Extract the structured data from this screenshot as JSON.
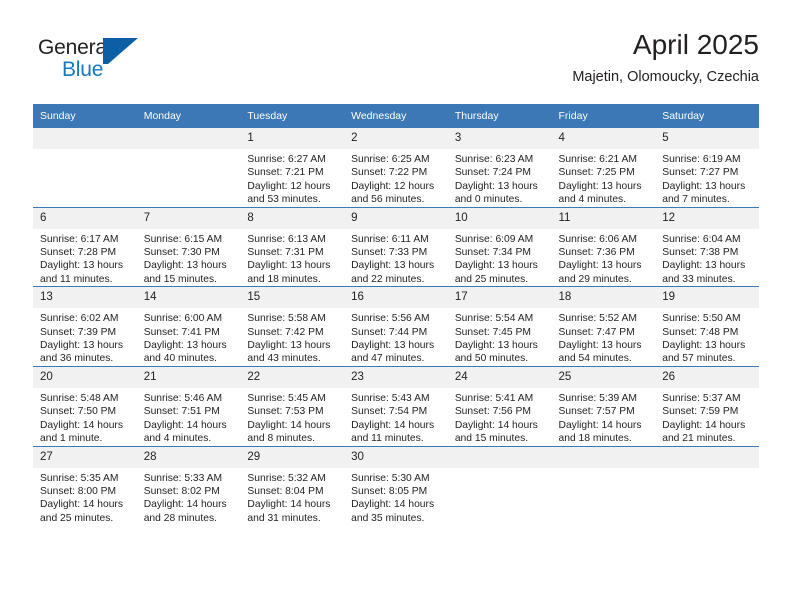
{
  "brand": {
    "name_part1": "General",
    "name_part2": "Blue",
    "mark": "triangle-logo"
  },
  "header": {
    "title": "April 2025",
    "subtitle": "Majetin, Olomoucky, Czechia"
  },
  "colors": {
    "header_blue": "#3b78b5",
    "brand_blue": "#1878be",
    "daynum_band": "#f1f1f1",
    "text": "#231f20"
  },
  "weekdays": [
    "Sunday",
    "Monday",
    "Tuesday",
    "Wednesday",
    "Thursday",
    "Friday",
    "Saturday"
  ],
  "weeks": [
    [
      {
        "day": "",
        "empty": true,
        "sunrise": "",
        "sunset": "",
        "daylight_line1": "",
        "daylight_line2": ""
      },
      {
        "day": "",
        "empty": true,
        "sunrise": "",
        "sunset": "",
        "daylight_line1": "",
        "daylight_line2": ""
      },
      {
        "day": "1",
        "empty": false,
        "sunrise": "Sunrise: 6:27 AM",
        "sunset": "Sunset: 7:21 PM",
        "daylight_line1": "Daylight: 12 hours",
        "daylight_line2": "and 53 minutes."
      },
      {
        "day": "2",
        "empty": false,
        "sunrise": "Sunrise: 6:25 AM",
        "sunset": "Sunset: 7:22 PM",
        "daylight_line1": "Daylight: 12 hours",
        "daylight_line2": "and 56 minutes."
      },
      {
        "day": "3",
        "empty": false,
        "sunrise": "Sunrise: 6:23 AM",
        "sunset": "Sunset: 7:24 PM",
        "daylight_line1": "Daylight: 13 hours",
        "daylight_line2": "and 0 minutes."
      },
      {
        "day": "4",
        "empty": false,
        "sunrise": "Sunrise: 6:21 AM",
        "sunset": "Sunset: 7:25 PM",
        "daylight_line1": "Daylight: 13 hours",
        "daylight_line2": "and 4 minutes."
      },
      {
        "day": "5",
        "empty": false,
        "sunrise": "Sunrise: 6:19 AM",
        "sunset": "Sunset: 7:27 PM",
        "daylight_line1": "Daylight: 13 hours",
        "daylight_line2": "and 7 minutes."
      }
    ],
    [
      {
        "day": "6",
        "empty": false,
        "sunrise": "Sunrise: 6:17 AM",
        "sunset": "Sunset: 7:28 PM",
        "daylight_line1": "Daylight: 13 hours",
        "daylight_line2": "and 11 minutes."
      },
      {
        "day": "7",
        "empty": false,
        "sunrise": "Sunrise: 6:15 AM",
        "sunset": "Sunset: 7:30 PM",
        "daylight_line1": "Daylight: 13 hours",
        "daylight_line2": "and 15 minutes."
      },
      {
        "day": "8",
        "empty": false,
        "sunrise": "Sunrise: 6:13 AM",
        "sunset": "Sunset: 7:31 PM",
        "daylight_line1": "Daylight: 13 hours",
        "daylight_line2": "and 18 minutes."
      },
      {
        "day": "9",
        "empty": false,
        "sunrise": "Sunrise: 6:11 AM",
        "sunset": "Sunset: 7:33 PM",
        "daylight_line1": "Daylight: 13 hours",
        "daylight_line2": "and 22 minutes."
      },
      {
        "day": "10",
        "empty": false,
        "sunrise": "Sunrise: 6:09 AM",
        "sunset": "Sunset: 7:34 PM",
        "daylight_line1": "Daylight: 13 hours",
        "daylight_line2": "and 25 minutes."
      },
      {
        "day": "11",
        "empty": false,
        "sunrise": "Sunrise: 6:06 AM",
        "sunset": "Sunset: 7:36 PM",
        "daylight_line1": "Daylight: 13 hours",
        "daylight_line2": "and 29 minutes."
      },
      {
        "day": "12",
        "empty": false,
        "sunrise": "Sunrise: 6:04 AM",
        "sunset": "Sunset: 7:38 PM",
        "daylight_line1": "Daylight: 13 hours",
        "daylight_line2": "and 33 minutes."
      }
    ],
    [
      {
        "day": "13",
        "empty": false,
        "sunrise": "Sunrise: 6:02 AM",
        "sunset": "Sunset: 7:39 PM",
        "daylight_line1": "Daylight: 13 hours",
        "daylight_line2": "and 36 minutes."
      },
      {
        "day": "14",
        "empty": false,
        "sunrise": "Sunrise: 6:00 AM",
        "sunset": "Sunset: 7:41 PM",
        "daylight_line1": "Daylight: 13 hours",
        "daylight_line2": "and 40 minutes."
      },
      {
        "day": "15",
        "empty": false,
        "sunrise": "Sunrise: 5:58 AM",
        "sunset": "Sunset: 7:42 PM",
        "daylight_line1": "Daylight: 13 hours",
        "daylight_line2": "and 43 minutes."
      },
      {
        "day": "16",
        "empty": false,
        "sunrise": "Sunrise: 5:56 AM",
        "sunset": "Sunset: 7:44 PM",
        "daylight_line1": "Daylight: 13 hours",
        "daylight_line2": "and 47 minutes."
      },
      {
        "day": "17",
        "empty": false,
        "sunrise": "Sunrise: 5:54 AM",
        "sunset": "Sunset: 7:45 PM",
        "daylight_line1": "Daylight: 13 hours",
        "daylight_line2": "and 50 minutes."
      },
      {
        "day": "18",
        "empty": false,
        "sunrise": "Sunrise: 5:52 AM",
        "sunset": "Sunset: 7:47 PM",
        "daylight_line1": "Daylight: 13 hours",
        "daylight_line2": "and 54 minutes."
      },
      {
        "day": "19",
        "empty": false,
        "sunrise": "Sunrise: 5:50 AM",
        "sunset": "Sunset: 7:48 PM",
        "daylight_line1": "Daylight: 13 hours",
        "daylight_line2": "and 57 minutes."
      }
    ],
    [
      {
        "day": "20",
        "empty": false,
        "sunrise": "Sunrise: 5:48 AM",
        "sunset": "Sunset: 7:50 PM",
        "daylight_line1": "Daylight: 14 hours",
        "daylight_line2": "and 1 minute."
      },
      {
        "day": "21",
        "empty": false,
        "sunrise": "Sunrise: 5:46 AM",
        "sunset": "Sunset: 7:51 PM",
        "daylight_line1": "Daylight: 14 hours",
        "daylight_line2": "and 4 minutes."
      },
      {
        "day": "22",
        "empty": false,
        "sunrise": "Sunrise: 5:45 AM",
        "sunset": "Sunset: 7:53 PM",
        "daylight_line1": "Daylight: 14 hours",
        "daylight_line2": "and 8 minutes."
      },
      {
        "day": "23",
        "empty": false,
        "sunrise": "Sunrise: 5:43 AM",
        "sunset": "Sunset: 7:54 PM",
        "daylight_line1": "Daylight: 14 hours",
        "daylight_line2": "and 11 minutes."
      },
      {
        "day": "24",
        "empty": false,
        "sunrise": "Sunrise: 5:41 AM",
        "sunset": "Sunset: 7:56 PM",
        "daylight_line1": "Daylight: 14 hours",
        "daylight_line2": "and 15 minutes."
      },
      {
        "day": "25",
        "empty": false,
        "sunrise": "Sunrise: 5:39 AM",
        "sunset": "Sunset: 7:57 PM",
        "daylight_line1": "Daylight: 14 hours",
        "daylight_line2": "and 18 minutes."
      },
      {
        "day": "26",
        "empty": false,
        "sunrise": "Sunrise: 5:37 AM",
        "sunset": "Sunset: 7:59 PM",
        "daylight_line1": "Daylight: 14 hours",
        "daylight_line2": "and 21 minutes."
      }
    ],
    [
      {
        "day": "27",
        "empty": false,
        "sunrise": "Sunrise: 5:35 AM",
        "sunset": "Sunset: 8:00 PM",
        "daylight_line1": "Daylight: 14 hours",
        "daylight_line2": "and 25 minutes."
      },
      {
        "day": "28",
        "empty": false,
        "sunrise": "Sunrise: 5:33 AM",
        "sunset": "Sunset: 8:02 PM",
        "daylight_line1": "Daylight: 14 hours",
        "daylight_line2": "and 28 minutes."
      },
      {
        "day": "29",
        "empty": false,
        "sunrise": "Sunrise: 5:32 AM",
        "sunset": "Sunset: 8:04 PM",
        "daylight_line1": "Daylight: 14 hours",
        "daylight_line2": "and 31 minutes."
      },
      {
        "day": "30",
        "empty": false,
        "sunrise": "Sunrise: 5:30 AM",
        "sunset": "Sunset: 8:05 PM",
        "daylight_line1": "Daylight: 14 hours",
        "daylight_line2": "and 35 minutes."
      },
      {
        "day": "",
        "empty": true,
        "sunrise": "",
        "sunset": "",
        "daylight_line1": "",
        "daylight_line2": ""
      },
      {
        "day": "",
        "empty": true,
        "sunrise": "",
        "sunset": "",
        "daylight_line1": "",
        "daylight_line2": ""
      },
      {
        "day": "",
        "empty": true,
        "sunrise": "",
        "sunset": "",
        "daylight_line1": "",
        "daylight_line2": ""
      }
    ]
  ]
}
